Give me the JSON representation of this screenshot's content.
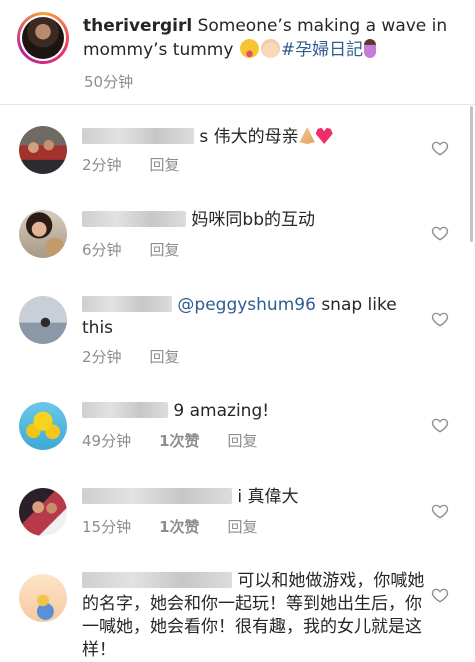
{
  "caption": {
    "username": "theriver girl",
    "text": "Someone’s making a wave in mommy’s tummy",
    "hashtag": "#孕婦日記",
    "time": "50分钟"
  },
  "comments": [
    {
      "text_visible": "s 伟大的母亲",
      "time": "2分钟",
      "reply": "回复",
      "likes": ""
    },
    {
      "text_visible": "妈咪同bb的互动",
      "time": "6分钟",
      "reply": "回复",
      "likes": ""
    },
    {
      "mention": "@peggyshum96",
      "text_visible": "snap like this",
      "time": "2分钟",
      "reply": "回复",
      "likes": ""
    },
    {
      "text_visible": "9 amazing!",
      "time": "49分钟",
      "reply": "回复",
      "likes": "1次赞"
    },
    {
      "text_visible": "i 真偉大",
      "time": "15分钟",
      "reply": "回复",
      "likes": "1次赞"
    },
    {
      "text_visible": "可以和她做游戏，你喊她的名字，她会和你一起玩！等到她出生后，你一喊她，她会看你！很有趣，我的女儿就是这样！",
      "time": "",
      "reply": "",
      "likes": ""
    }
  ],
  "icons": {
    "heart": "heart-outline-icon",
    "emoji": [
      "squinting-tongue-emoji",
      "baby-emoji",
      "pregnant-woman-emoji",
      "folded-hands-emoji",
      "red-heart-emoji"
    ]
  },
  "colors": {
    "text": "#262626",
    "meta": "#8e8e8e",
    "link": "#2f5d8f",
    "ring_start": "#f9a23a",
    "ring_end": "#b7259f"
  }
}
